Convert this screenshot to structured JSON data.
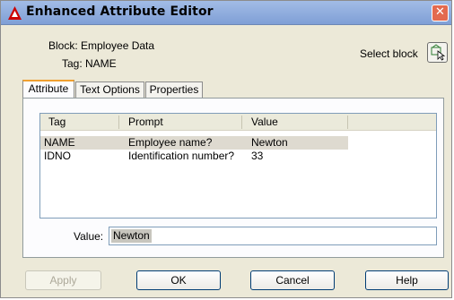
{
  "window": {
    "title": "Enhanced Attribute Editor",
    "close_glyph": "✕"
  },
  "block_info": {
    "block_label": "Block: Employee Data",
    "tag_label": "Tag: NAME"
  },
  "select_block": {
    "label": "Select block"
  },
  "tabs": [
    {
      "label": "Attribute",
      "active": true
    },
    {
      "label": "Text Options",
      "active": false
    },
    {
      "label": "Properties",
      "active": false
    }
  ],
  "table": {
    "columns": [
      "Tag",
      "Prompt",
      "Value"
    ],
    "rows": [
      {
        "tag": "NAME",
        "prompt": "Employee name?",
        "value": "Newton",
        "selected": true
      },
      {
        "tag": "IDNO",
        "prompt": "Identification number?",
        "value": "33",
        "selected": false
      }
    ]
  },
  "value_field": {
    "label": "Value:",
    "value": "Newton"
  },
  "buttons": {
    "apply": "Apply",
    "ok": "OK",
    "cancel": "Cancel",
    "help": "Help"
  },
  "colors": {
    "accent": "#f0a030",
    "title_bar": "#8fb0e0",
    "close": "#e36a4f",
    "autocad_red": "#cc0000"
  }
}
